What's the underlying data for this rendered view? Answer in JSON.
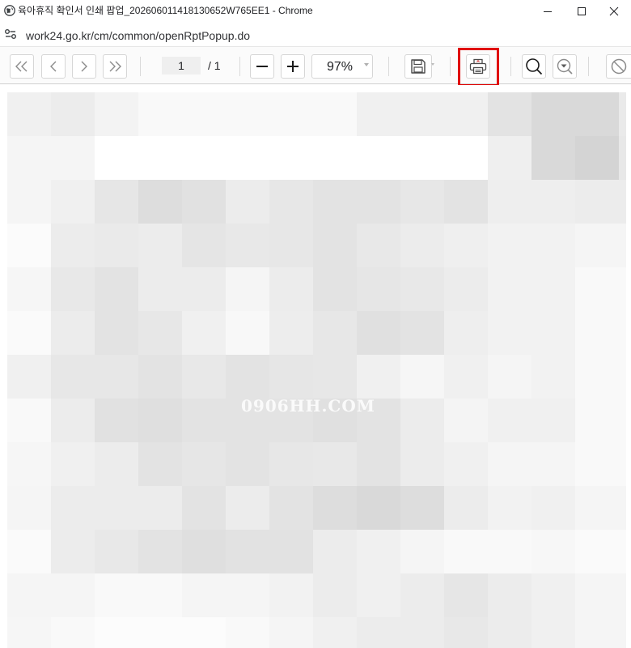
{
  "window": {
    "title": "육아휴직 확인서 인쇄 팝업_202606011418130652W765EE1 - Chrome",
    "favicon_icon": "globe-icon"
  },
  "address_bar": {
    "url": "work24.go.kr/cm/common/openRptPopup.do",
    "site_info_icon": "tune-icon"
  },
  "toolbar": {
    "first_page_icon": "double-chevron-left-icon",
    "prev_page_icon": "chevron-left-icon",
    "next_page_icon": "chevron-right-icon",
    "last_page_icon": "double-chevron-right-icon",
    "current_page": "1",
    "total_pages": "/ 1",
    "zoom_out_icon": "minus-icon",
    "zoom_in_icon": "plus-icon",
    "zoom_level": "97%",
    "save_icon": "floppy-disk-icon",
    "print_icon": "printer-icon",
    "search_icon": "magnifier-icon",
    "search_next_icon": "magnifier-down-icon",
    "close_icon": "no-entry-icon",
    "highlight_color": "#e00000"
  },
  "document": {
    "pixelated": true,
    "watermark": "0906HH.COM",
    "mosaic_gray_levels": [
      [
        240,
        236,
        243,
        249,
        249,
        249,
        249,
        249,
        240,
        240,
        240,
        227,
        217,
        217,
        234
      ],
      [
        245,
        245,
        255,
        255,
        255,
        255,
        255,
        255,
        255,
        255,
        255,
        239,
        217,
        212,
        232
      ],
      [
        245,
        240,
        230,
        221,
        225,
        236,
        231,
        227,
        227,
        231,
        227,
        238,
        238,
        236,
        236
      ],
      [
        251,
        236,
        234,
        236,
        229,
        232,
        231,
        227,
        232,
        236,
        239,
        242,
        242,
        245,
        245
      ],
      [
        246,
        232,
        227,
        236,
        236,
        245,
        236,
        227,
        230,
        232,
        236,
        242,
        242,
        249,
        249
      ],
      [
        250,
        236,
        227,
        231,
        240,
        248,
        237,
        231,
        224,
        227,
        238,
        242,
        242,
        249,
        249
      ],
      [
        240,
        231,
        231,
        227,
        232,
        227,
        230,
        231,
        240,
        246,
        240,
        245,
        242,
        249,
        249
      ],
      [
        249,
        236,
        225,
        223,
        227,
        227,
        227,
        224,
        227,
        236,
        244,
        240,
        240,
        249,
        249
      ],
      [
        246,
        240,
        236,
        227,
        230,
        227,
        231,
        232,
        227,
        236,
        240,
        245,
        245,
        249,
        249
      ],
      [
        245,
        236,
        236,
        236,
        227,
        236,
        227,
        221,
        217,
        221,
        236,
        242,
        240,
        245,
        245
      ],
      [
        250,
        236,
        232,
        227,
        223,
        226,
        226,
        236,
        240,
        245,
        249,
        249,
        247,
        250,
        250
      ],
      [
        245,
        245,
        249,
        249,
        245,
        245,
        242,
        236,
        240,
        236,
        230,
        236,
        240,
        245,
        245
      ],
      [
        246,
        249,
        252,
        252,
        252,
        249,
        245,
        240,
        236,
        236,
        232,
        236,
        240,
        245,
        245
      ]
    ]
  }
}
